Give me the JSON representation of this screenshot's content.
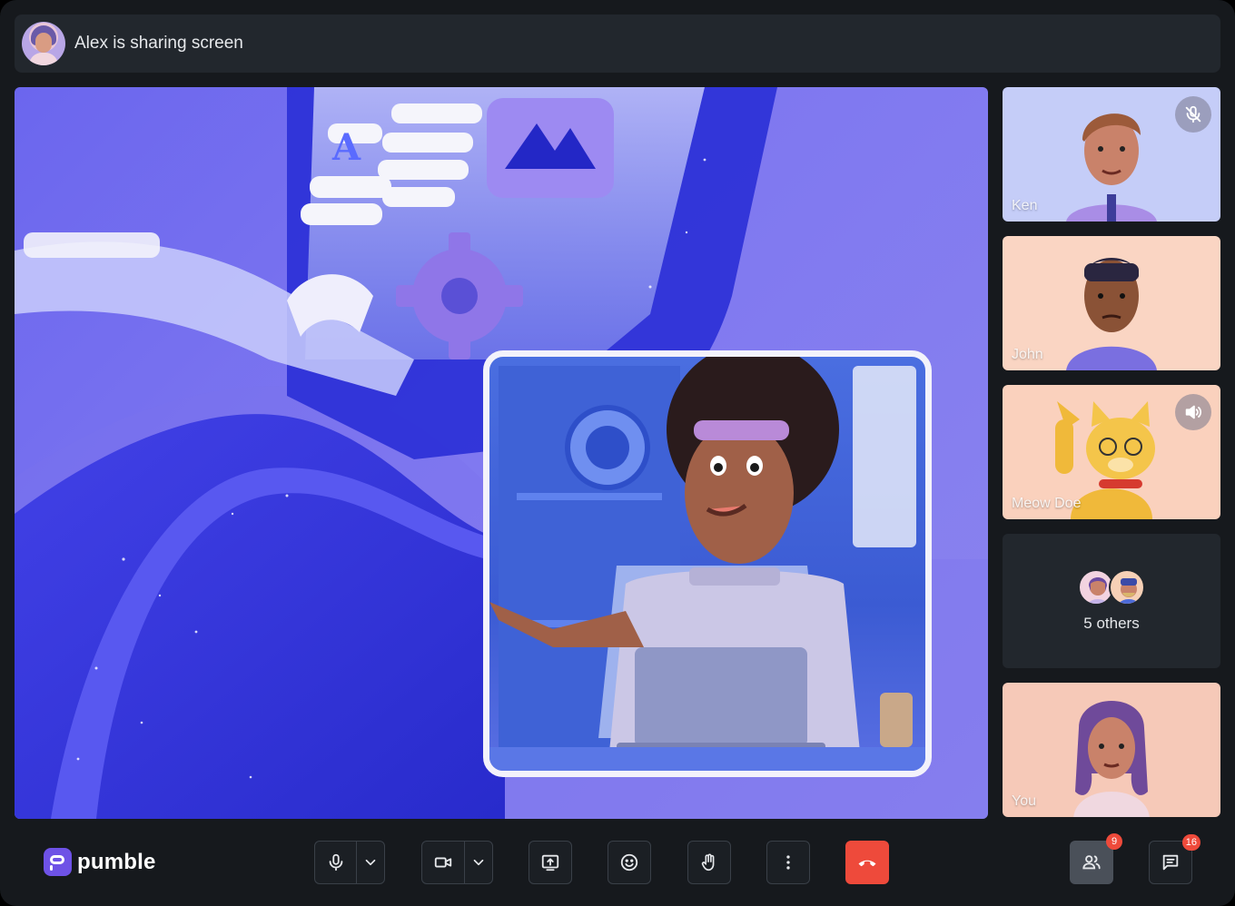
{
  "header": {
    "presenter_avatar_icon": "presenter-avatar",
    "status_text": "Alex is sharing screen"
  },
  "participants": [
    {
      "name": "Ken",
      "status_icon": "mic-muted-icon",
      "bg": "#c5cdf8"
    },
    {
      "name": "John",
      "status_icon": "",
      "bg": "#fad5c3"
    },
    {
      "name": "Meow Doe",
      "status_icon": "speaker-icon",
      "bg": "#fad1bd"
    }
  ],
  "others": {
    "label": "5 others"
  },
  "self_tile": {
    "name": "You",
    "bg": "#f6c9b8"
  },
  "brand": {
    "name": "pumble",
    "color": "#6e52e6"
  },
  "controls": {
    "mic": "microphone-icon",
    "camera": "video-camera-icon",
    "share": "share-screen-icon",
    "reactions": "emoji-icon",
    "raise_hand": "raise-hand-icon",
    "more": "more-vertical-icon",
    "end_call": "end-call-icon"
  },
  "participants_button": {
    "badge": "9"
  },
  "chat_button": {
    "badge": "16"
  },
  "colors": {
    "accent_red": "#ee4a3b",
    "panel": "#22272d",
    "background": "#16191d"
  }
}
